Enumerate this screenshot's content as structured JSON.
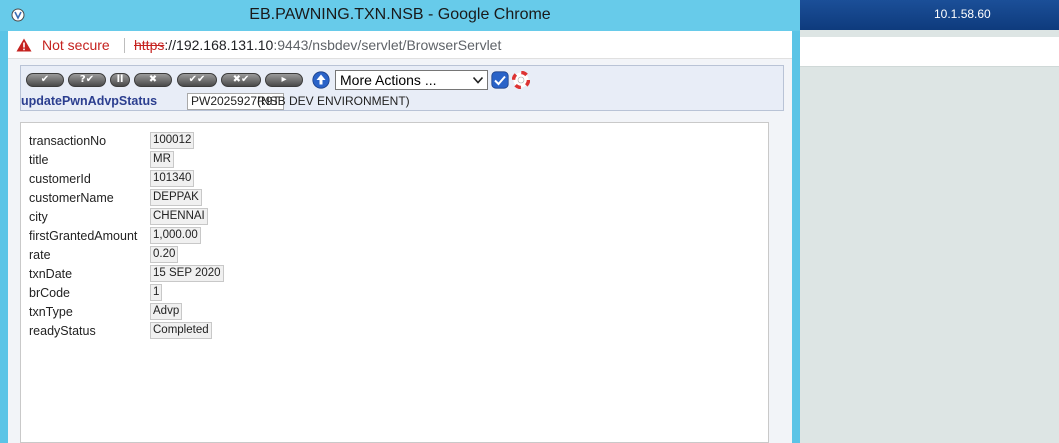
{
  "window": {
    "title": "EB.PAWNING.TXN.NSB - Google Chrome",
    "not_secure": "Not secure",
    "url_scheme": "https",
    "url_host": "://192.168.131.10",
    "url_rest": ":9443/nsbdev/servlet/BrowserServlet"
  },
  "toolbar": {
    "more_actions": "More Actions ...",
    "version_label": "updatePwnAdvpStatus",
    "record_id": "PW2025927R9T",
    "environment": "(NSB DEV ENVIRONMENT)"
  },
  "fields": [
    {
      "label": "transactionNo",
      "value": "100012"
    },
    {
      "label": "title",
      "value": "MR"
    },
    {
      "label": "customerId",
      "value": "101340"
    },
    {
      "label": "customerName",
      "value": "DEPPAK"
    },
    {
      "label": "city",
      "value": "CHENNAI"
    },
    {
      "label": "firstGrantedAmount",
      "value": "1,000.00"
    },
    {
      "label": "rate",
      "value": "0.20"
    },
    {
      "label": "txnDate",
      "value": "15 SEP 2020"
    },
    {
      "label": "brCode",
      "value": "1"
    },
    {
      "label": "txnType",
      "value": "Advp"
    },
    {
      "label": "readyStatus",
      "value": "Completed"
    }
  ],
  "background": {
    "ip_address": "10.1.58.60"
  },
  "colors": {
    "titlebar": "#67cbea",
    "not_secure": "#c5221f",
    "label_blue": "#2b3e8f"
  }
}
